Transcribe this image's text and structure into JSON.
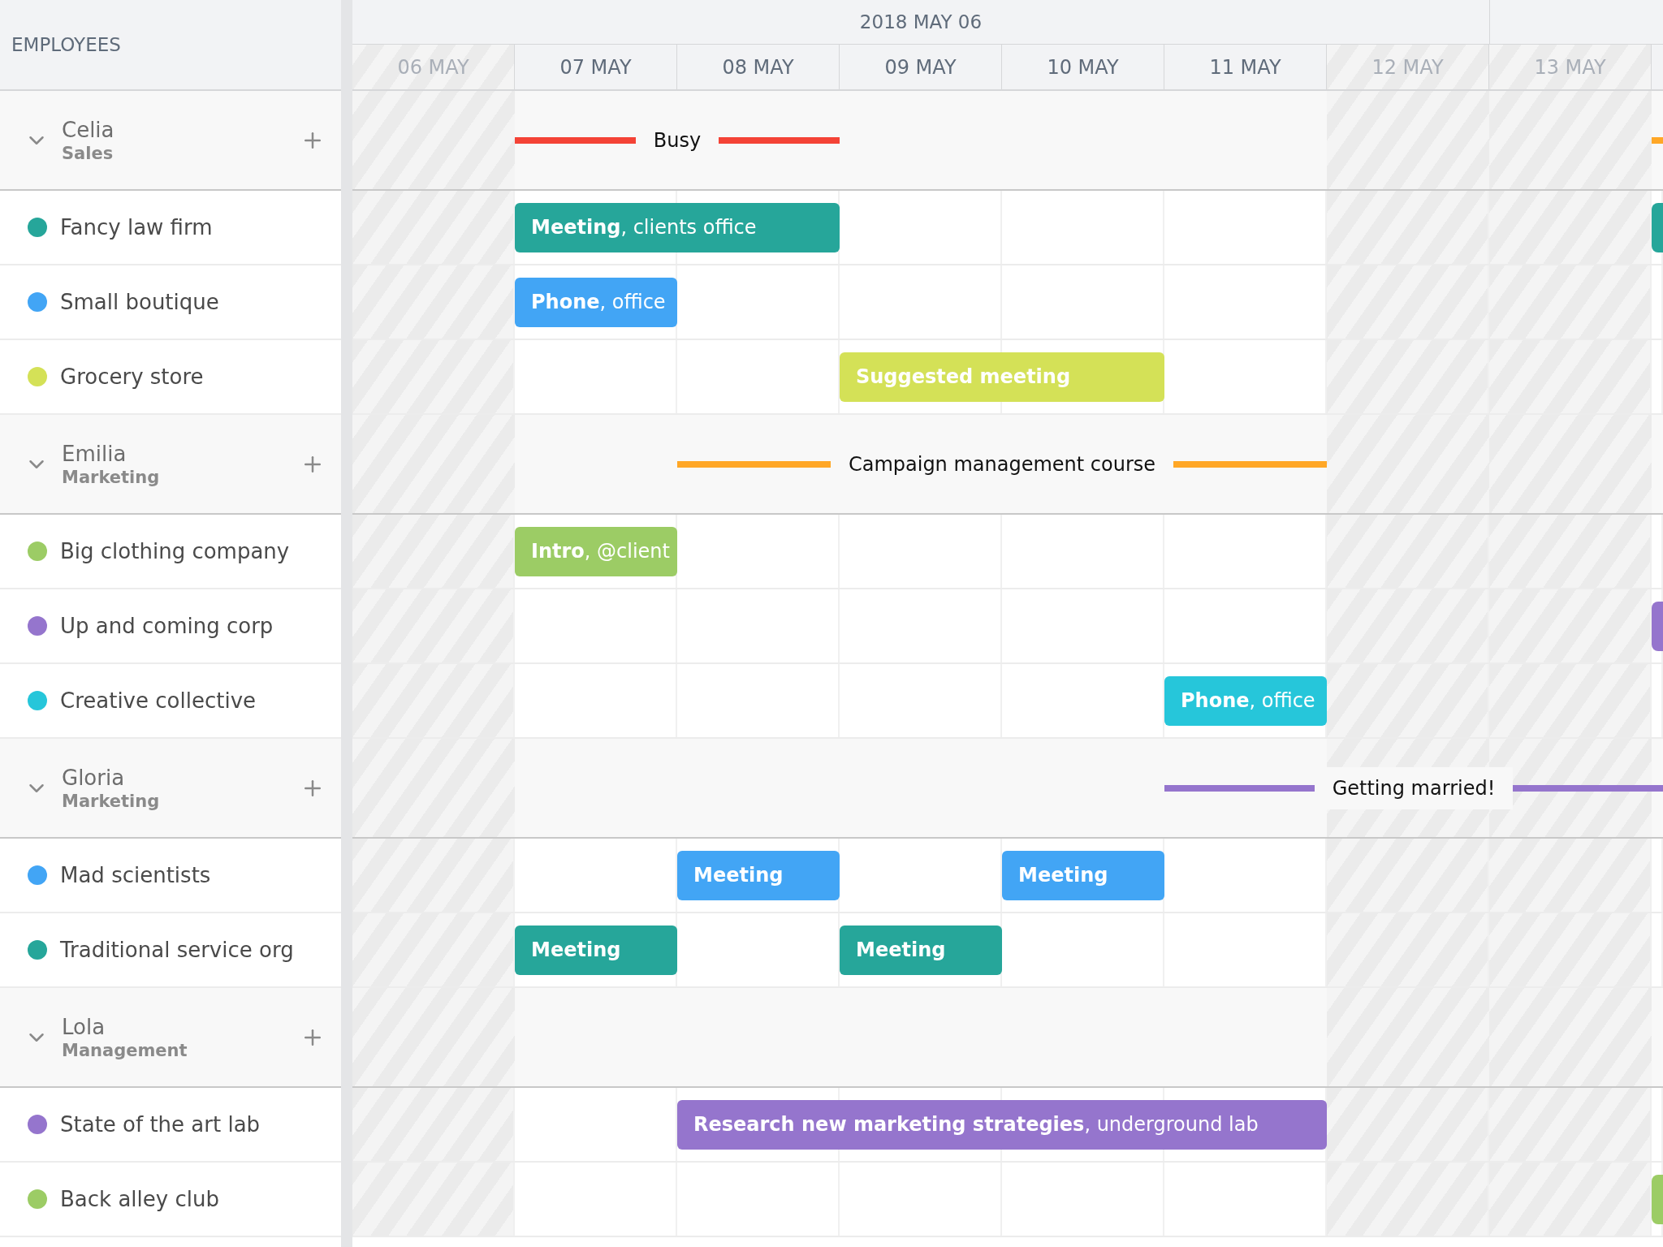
{
  "sidebar": {
    "title": "EMPLOYEES"
  },
  "timeline": {
    "range_label": "2018 MAY 06",
    "days": [
      {
        "label": "06 MAY",
        "weekend": true
      },
      {
        "label": "07 MAY",
        "weekend": false
      },
      {
        "label": "08 MAY",
        "weekend": false
      },
      {
        "label": "09 MAY",
        "weekend": false
      },
      {
        "label": "10 MAY",
        "weekend": false
      },
      {
        "label": "11 MAY",
        "weekend": false
      },
      {
        "label": "12 MAY",
        "weekend": true
      },
      {
        "label": "13 MAY",
        "weekend": true
      }
    ]
  },
  "employees": [
    {
      "name": "Celia",
      "department": "Sales",
      "expanded": true,
      "bars": [
        {
          "label": "Busy",
          "color": "#f44336"
        },
        {
          "color": "#ffa726"
        }
      ],
      "clients": [
        {
          "name": "Fancy law firm",
          "color": "#26a69a",
          "events": [
            {
              "title": "Meeting",
              "detail": ", clients office",
              "color": "#26a69a"
            },
            {
              "color": "#26a69a"
            }
          ]
        },
        {
          "name": "Small boutique",
          "color": "#42a5f5",
          "events": [
            {
              "title": "Phone",
              "detail": ", office",
              "color": "#42a5f5"
            }
          ]
        },
        {
          "name": "Grocery store",
          "color": "#d4e157",
          "events": [
            {
              "title": "Suggested meeting",
              "color": "#d4e157"
            }
          ]
        }
      ]
    },
    {
      "name": "Emilia",
      "department": "Marketing",
      "expanded": true,
      "bars": [
        {
          "label": "Campaign management course",
          "color": "#ffa726"
        }
      ],
      "clients": [
        {
          "name": "Big clothing company",
          "color": "#9ccc65",
          "events": [
            {
              "title": "Intro",
              "detail": ", @client",
              "color": "#9ccc65"
            }
          ]
        },
        {
          "name": "Up and coming corp",
          "color": "#9575cd",
          "events": [
            {
              "color": "#9575cd"
            }
          ]
        },
        {
          "name": "Creative collective",
          "color": "#26c6da",
          "events": [
            {
              "title": "Phone",
              "detail": ", office",
              "color": "#26c6da"
            }
          ]
        }
      ]
    },
    {
      "name": "Gloria",
      "department": "Marketing",
      "expanded": true,
      "bars": [
        {
          "label": "Getting married!",
          "color": "#9575cd"
        }
      ],
      "clients": [
        {
          "name": "Mad scientists",
          "color": "#42a5f5",
          "events": [
            {
              "title": "Meeting",
              "color": "#42a5f5"
            },
            {
              "title": "Meeting",
              "color": "#42a5f5"
            }
          ]
        },
        {
          "name": "Traditional service org",
          "color": "#26a69a",
          "events": [
            {
              "title": "Meeting",
              "color": "#26a69a"
            },
            {
              "title": "Meeting",
              "color": "#26a69a"
            }
          ]
        }
      ]
    },
    {
      "name": "Lola",
      "department": "Management",
      "expanded": true,
      "clients": [
        {
          "name": "State of the art lab",
          "color": "#9575cd",
          "events": [
            {
              "title": "Research new marketing strategies",
              "detail": ", underground lab",
              "color": "#9575cd"
            }
          ]
        },
        {
          "name": "Back alley club",
          "color": "#9ccc65",
          "events": [
            {
              "color": "#9ccc65"
            }
          ]
        }
      ]
    }
  ]
}
